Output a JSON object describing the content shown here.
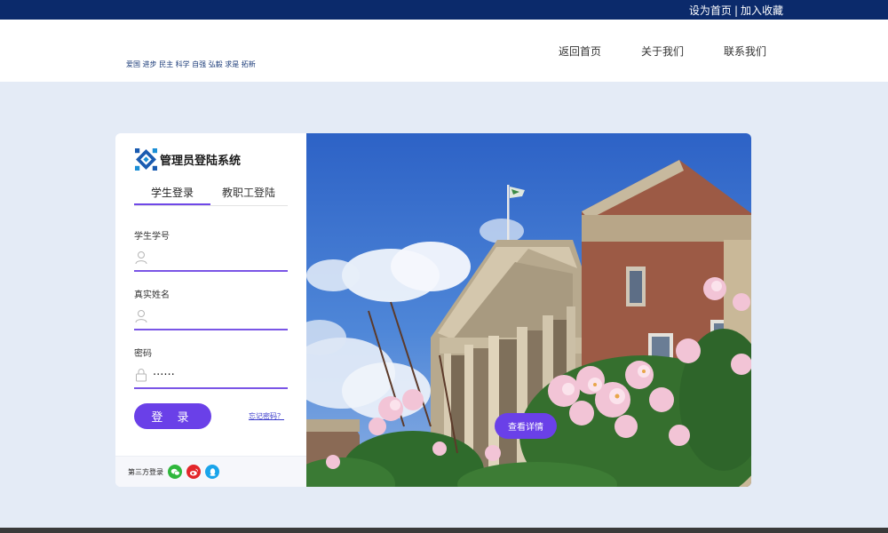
{
  "topbar": {
    "set_home": "设为首页",
    "separator": "|",
    "add_favorite": "加入收藏"
  },
  "header": {
    "slogan": "爱国 进步 民主 科学  自强 弘毅 求是 拓新",
    "nav": [
      "返回首页",
      "关于我们",
      "联系我们"
    ]
  },
  "login": {
    "system_title": "管理员登陆系统",
    "tabs": [
      "学生登录",
      "教职工登陆"
    ],
    "active_tab": "学生登录",
    "fields": {
      "student_id": {
        "label": "学生学号",
        "value": "",
        "icon": "user-icon"
      },
      "real_name": {
        "label": "真实姓名",
        "value": "",
        "icon": "user-icon"
      },
      "password": {
        "label": "密码",
        "value": "······",
        "icon": "lock-icon"
      }
    },
    "login_button": "登 录",
    "forgot_link": "忘记密码？",
    "third_party_label": "第三方登录",
    "third_party_icons": [
      "wechat-icon",
      "weibo-icon",
      "qq-icon"
    ]
  },
  "photo": {
    "detail_button": "查看详情",
    "subject": "campus-building-photo"
  },
  "colors": {
    "topbar": "#0b2a6b",
    "page_bg": "#e4ebf6",
    "accent": "#6a40e8",
    "wechat": "#2fb73c",
    "weibo": "#e3262a",
    "qq": "#1aa4ea"
  }
}
